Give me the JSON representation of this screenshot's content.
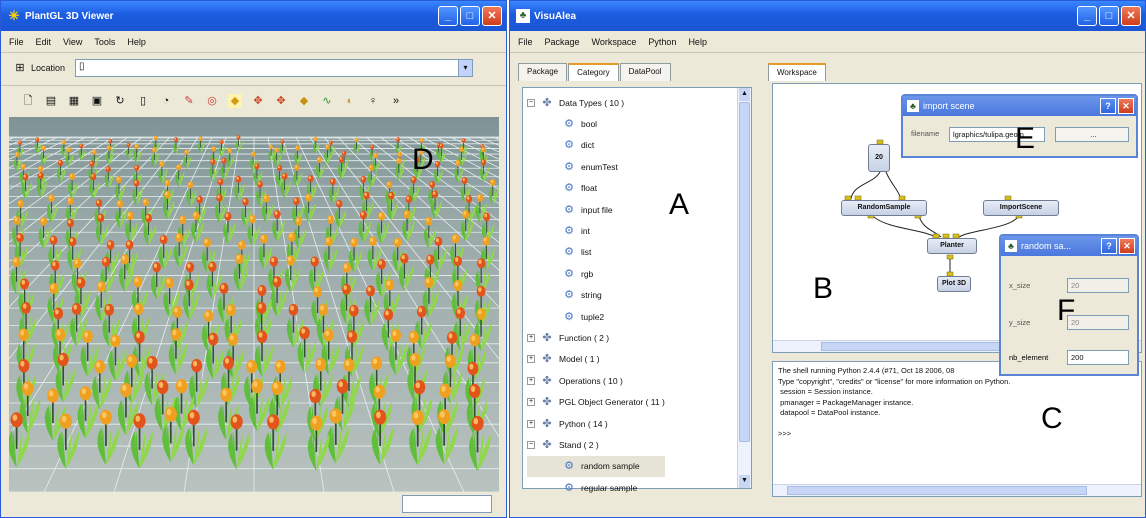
{
  "left_window": {
    "title": "PlantGL 3D Viewer",
    "menu": [
      "File",
      "Edit",
      "View",
      "Tools",
      "Help"
    ],
    "location_label": "Location",
    "location_value": "",
    "toolbar_icons": [
      "save-icon",
      "open-icon",
      "floppy-icon",
      "frame-icon",
      "refresh-icon",
      "page-icon",
      "info-icon",
      "brush-icon",
      "target-icon",
      "camera-front-icon",
      "camera-left-icon",
      "camera-top-icon",
      "camera-right-icon",
      "axis-icon",
      "light-icon"
    ],
    "status_value": "",
    "region_label": "D"
  },
  "right_window": {
    "title": "VisuAlea",
    "menu": [
      "File",
      "Package",
      "Workspace",
      "Python",
      "Help"
    ],
    "left_tabs": [
      "Package",
      "Category",
      "DataPool"
    ],
    "active_left_tab": "Category",
    "workspace_tab": "Workspace",
    "tree": [
      {
        "label": "Data Types ( 10 )",
        "expanded": true
      },
      {
        "label": "bool",
        "child": true
      },
      {
        "label": "dict",
        "child": true
      },
      {
        "label": "enumTest",
        "child": true
      },
      {
        "label": "float",
        "child": true
      },
      {
        "label": "input file",
        "child": true
      },
      {
        "label": "int",
        "child": true
      },
      {
        "label": "list",
        "child": true
      },
      {
        "label": "rgb",
        "child": true
      },
      {
        "label": "string",
        "child": true
      },
      {
        "label": "tuple2",
        "child": true
      },
      {
        "label": "Function ( 2 )",
        "expanded": false
      },
      {
        "label": "Model ( 1 )",
        "expanded": false
      },
      {
        "label": "Operations ( 10 )",
        "expanded": false
      },
      {
        "label": "PGL Object Generator ( 11 )",
        "expanded": false
      },
      {
        "label": "Python ( 14 )",
        "expanded": false
      },
      {
        "label": "Stand ( 2 )",
        "expanded": true
      },
      {
        "label": "random sample",
        "child": true,
        "selected": true
      },
      {
        "label": "regular sample",
        "child": true
      }
    ],
    "nodes": {
      "n20": "20",
      "random": "RandomSample",
      "import": "ImportScene",
      "planter": "Planter",
      "plot": "Plot 3D"
    },
    "shell_lines": [
      "The shell running Python 2.4.4 (#71, Oct 18 2006, 08",
      "Type \"copyright\", \"credits\" or \"license\" for more information on Python.",
      " session = Session instance.",
      " pmanager = PackageManager instance.",
      " datapool = DataPool instance.",
      "",
      ">>>"
    ],
    "dialog_import": {
      "title": "import scene",
      "filename_label": "filename",
      "filename_value": "lgraphics/tulipa.geom",
      "browse_label": "..."
    },
    "dialog_random": {
      "title": "random sa...",
      "x_label": "x_size",
      "x_value": "20",
      "y_label": "y_size",
      "y_value": "20",
      "nb_label": "nb_element",
      "nb_value": "200"
    },
    "labels": {
      "A": "A",
      "B": "B",
      "C": "C",
      "E": "E",
      "F": "F"
    }
  }
}
